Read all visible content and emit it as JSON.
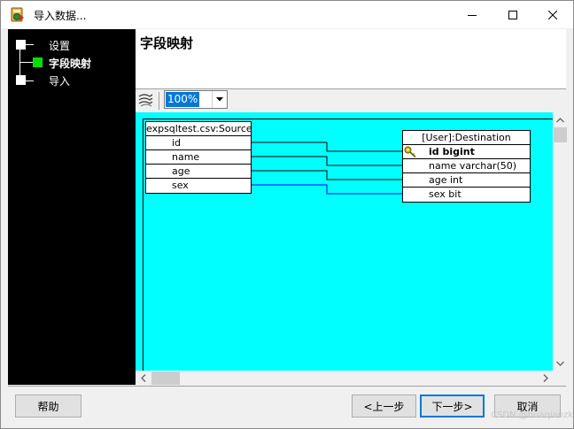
{
  "window": {
    "title": "导入数据...",
    "app_icon": "import-app-icon",
    "controls": [
      "minimize-icon",
      "maximize-icon",
      "close-icon"
    ]
  },
  "nav": {
    "items": [
      {
        "label": "设置",
        "state": "done"
      },
      {
        "label": "字段映射",
        "state": "current"
      },
      {
        "label": "导入",
        "state": "pending"
      }
    ]
  },
  "header": {
    "title": "字段映射"
  },
  "toolbar": {
    "layout_icon": "auto-layout-icon",
    "zoom": "100%"
  },
  "diagram": {
    "source": {
      "title": "expsqltest.csv:Source",
      "fields": [
        "id",
        "name",
        "age",
        "sex"
      ]
    },
    "destination": {
      "title": "[User]:Destination",
      "fields": [
        {
          "label": "id  bigint",
          "primary_key": true
        },
        {
          "label": "name  varchar(50)",
          "primary_key": false
        },
        {
          "label": "age  int",
          "primary_key": false
        },
        {
          "label": "sex  bit",
          "primary_key": false
        }
      ]
    },
    "mappings": [
      {
        "from": "id",
        "to": "id"
      },
      {
        "from": "name",
        "to": "name"
      },
      {
        "from": "age",
        "to": "age"
      },
      {
        "from": "sex",
        "to": "sex"
      }
    ],
    "colors": {
      "background": "#00ffff",
      "link": "#0000ff",
      "primary_key_icon": "#b8a000"
    }
  },
  "footer": {
    "help": "帮助",
    "back": "<上一步",
    "next": "下一步>",
    "cancel": "取消"
  },
  "watermark": "CSDN @huaqianzkh"
}
